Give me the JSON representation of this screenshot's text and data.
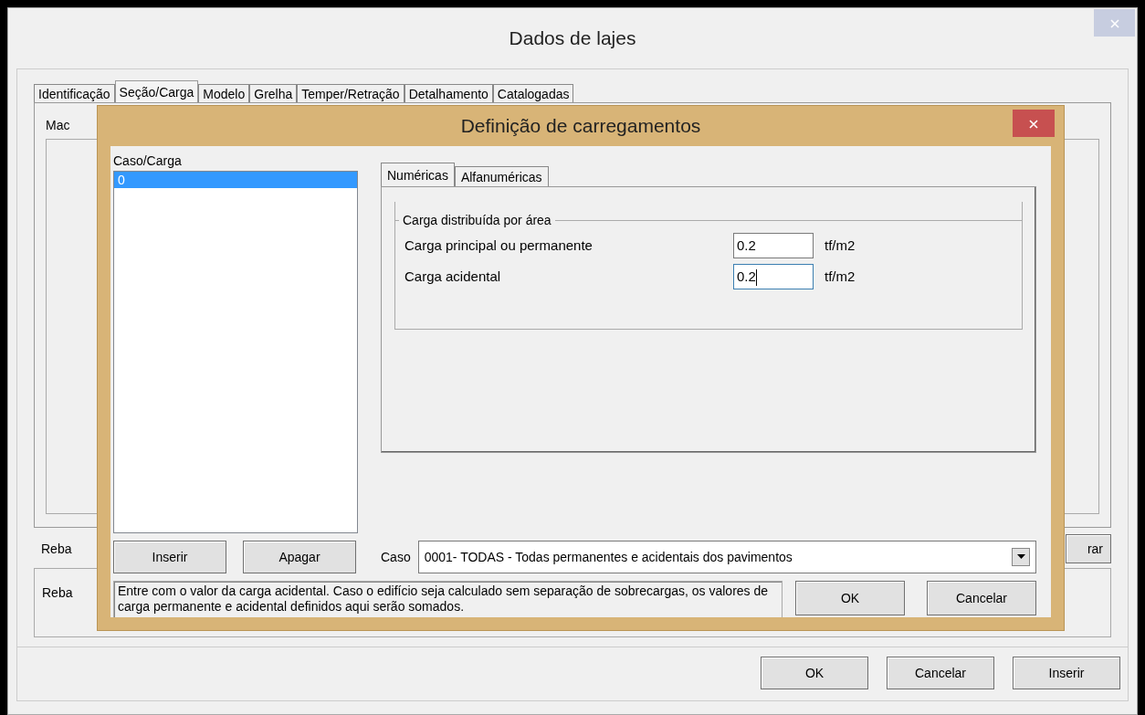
{
  "window": {
    "title": "Dados de lajes"
  },
  "tabs": [
    {
      "label": "Identificação",
      "selected": false
    },
    {
      "label": "Seção/Carga",
      "selected": true
    },
    {
      "label": "Modelo",
      "selected": false
    },
    {
      "label": "Grelha",
      "selected": false
    },
    {
      "label": "Temper/Retração",
      "selected": false
    },
    {
      "label": "Detalhamento",
      "selected": false
    },
    {
      "label": "Catalogadas",
      "selected": false
    }
  ],
  "panel_label": "Mac",
  "row_label": "Reba",
  "row_button": "rar",
  "box_text": "Reba",
  "buttons": [
    "OK",
    "Cancelar",
    "Inserir"
  ],
  "dialog": {
    "title": "Definição de carregamentos",
    "list_label": "Caso/Carga",
    "list_items": [
      {
        "label": "0",
        "selected": true
      }
    ],
    "tabs": [
      {
        "label": "Numéricas",
        "selected": true
      },
      {
        "label": "Alfanuméricas",
        "selected": false
      }
    ],
    "group": {
      "title": "Carga distribuída por área",
      "fields": [
        {
          "label": "Carga principal ou permanente",
          "value": "0.2",
          "unit": "tf/m2",
          "focused": false
        },
        {
          "label": "Carga acidental",
          "value": "0.2",
          "unit": "tf/m2",
          "focused": true
        }
      ]
    },
    "list_buttons": [
      "Inserir",
      "Apagar"
    ],
    "case": {
      "label": "Caso",
      "value": "0001- TODAS - Todas permanentes e acidentais dos pavimentos"
    },
    "hint": "Entre com o valor da carga acidental. Caso o edifício seja calculado sem separação de sobrecargas, os valores de carga permanente e  acidental definidos aqui serão somados.",
    "actions": [
      "OK",
      "Cancelar"
    ]
  }
}
